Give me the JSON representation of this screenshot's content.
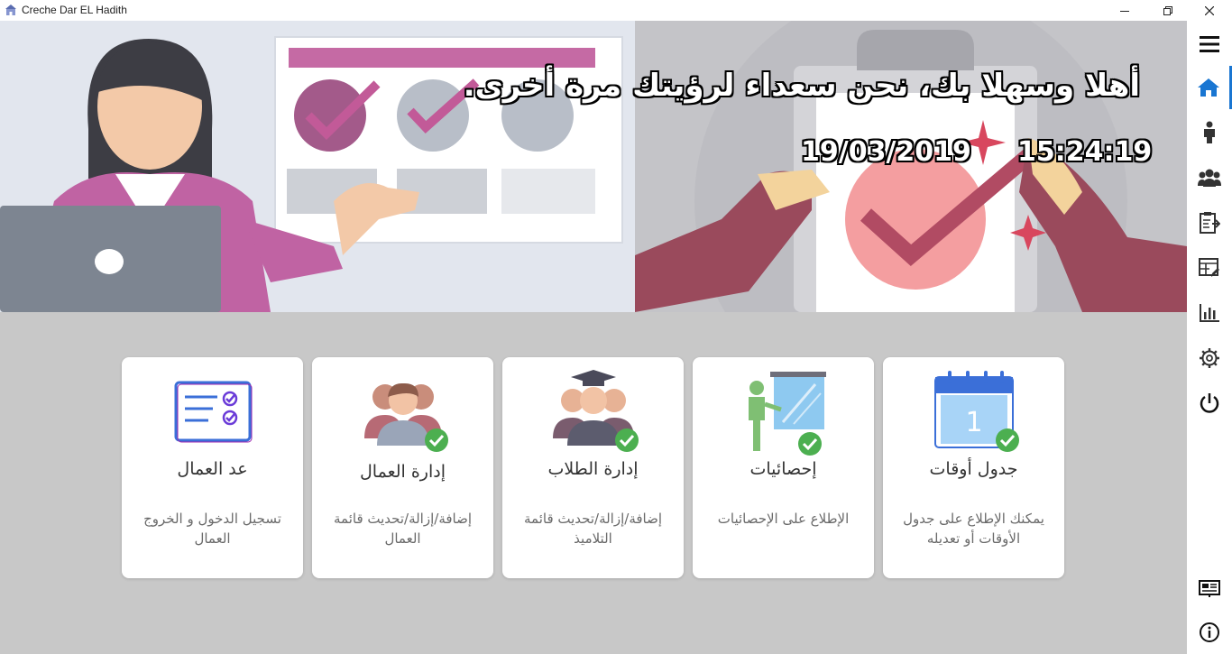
{
  "window": {
    "title": "Creche Dar EL Hadith"
  },
  "hero": {
    "greeting": "أهلا وسهلا بك، نحن سعداء لرؤيتك مرة أخرى.",
    "date": "19/03/2019",
    "time": "15:24:19"
  },
  "cards": [
    {
      "title": "جدول أوقات",
      "desc": "يمكنك الإطلاع على جدول الأوقات أو تعديله",
      "icon": "calendar-icon"
    },
    {
      "title": "إحصائيات",
      "desc": "الإطلاع على الإحصائيات",
      "icon": "presentation-icon"
    },
    {
      "title": "إدارة الطلاب",
      "desc": "إضافة/إزالة/تحديث قائمة التلاميذ",
      "icon": "students-icon"
    },
    {
      "title": "إدارة العمال",
      "desc": "إضافة/إزالة/تحديث قائمة العمال",
      "icon": "workers-icon"
    },
    {
      "title": "عد العمال",
      "desc": "تسجيل الدخول و الخروج العمال",
      "icon": "checklist-icon"
    }
  ],
  "sidebar": {
    "items": [
      "menu-icon",
      "home-icon",
      "child-icon",
      "group-icon",
      "clipboard-icon",
      "schedule-edit-icon",
      "chart-icon",
      "settings-icon",
      "power-icon",
      "presentation-board-icon",
      "info-icon"
    ],
    "accent": "#1976d2"
  },
  "colors": {
    "background": "#c8c8c8",
    "check": "#4caf50"
  }
}
